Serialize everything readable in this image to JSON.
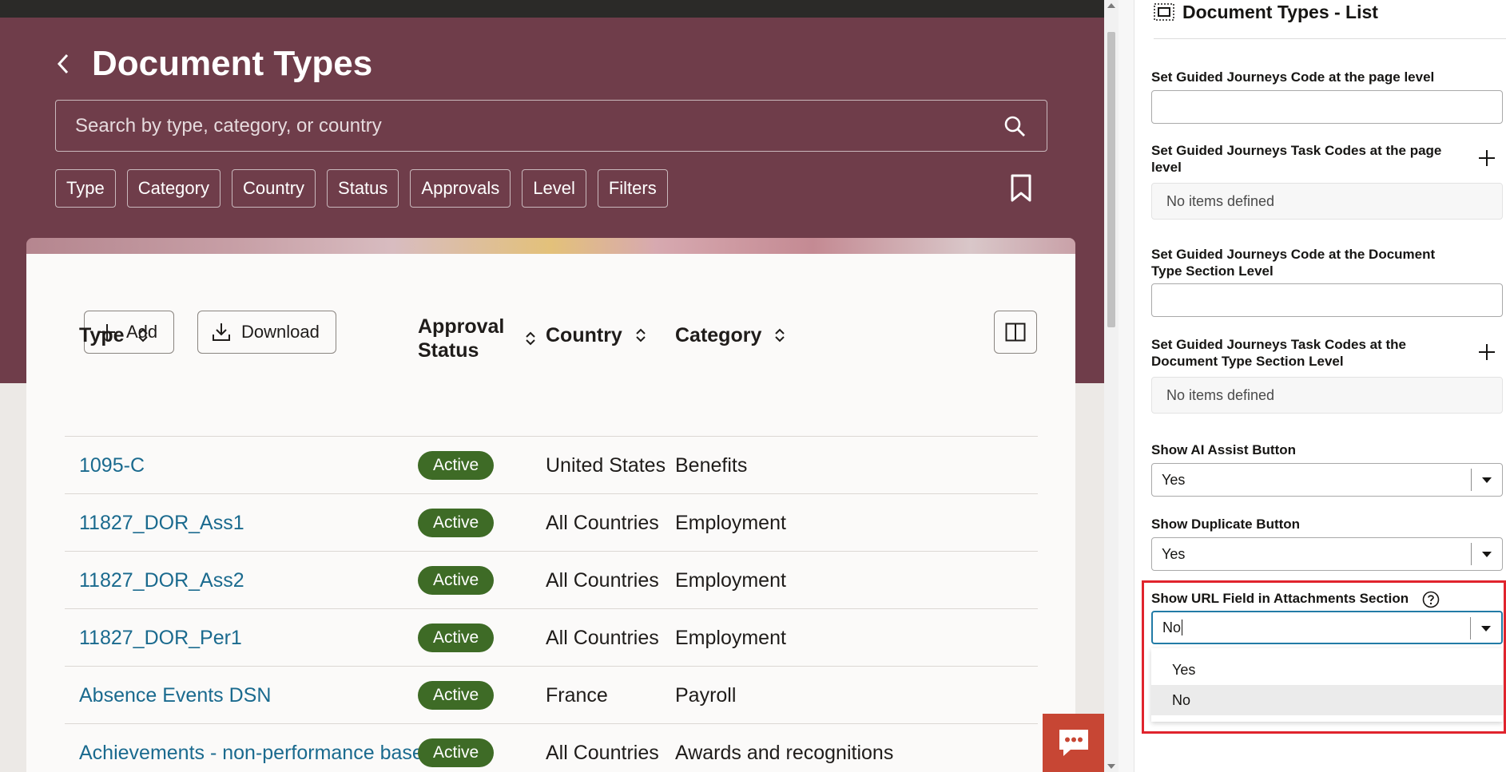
{
  "header": {
    "title": "Document Types",
    "search_placeholder": "Search by type, category, or country",
    "filter_chips": [
      "Type",
      "Category",
      "Country",
      "Status",
      "Approvals",
      "Level",
      "Filters"
    ]
  },
  "toolbar": {
    "add_label": "Add",
    "download_label": "Download"
  },
  "table": {
    "columns": [
      "Type",
      "Approval Status",
      "Country",
      "Category"
    ],
    "rows": [
      {
        "type": "1095-C",
        "status": "Active",
        "country": "United States",
        "category": "Benefits"
      },
      {
        "type": "11827_DOR_Ass1",
        "status": "Active",
        "country": "All Countries",
        "category": "Employment"
      },
      {
        "type": "11827_DOR_Ass2",
        "status": "Active",
        "country": "All Countries",
        "category": "Employment"
      },
      {
        "type": "11827_DOR_Per1",
        "status": "Active",
        "country": "All Countries",
        "category": "Employment"
      },
      {
        "type": "Absence Events DSN",
        "status": "Active",
        "country": "France",
        "category": "Payroll"
      },
      {
        "type": "Achievements - non-performance based",
        "status": "Active",
        "country": "All Countries",
        "category": "Awards and recognitions"
      }
    ]
  },
  "panel": {
    "title": "Document Types - List",
    "fields": {
      "gj_page_code_label": "Set Guided Journeys Code at the page level",
      "gj_page_code_value": "",
      "gj_page_tasks_label": "Set Guided Journeys Task Codes at the page level",
      "gj_page_tasks_empty": "No items defined",
      "gj_section_code_label": "Set Guided Journeys Code at the Document Type Section Level",
      "gj_section_code_value": "",
      "gj_section_tasks_label": "Set Guided Journeys Task Codes at the Document Type Section Level",
      "gj_section_tasks_empty": "No items defined",
      "ai_assist_label": "Show AI Assist Button",
      "ai_assist_value": "Yes",
      "duplicate_label": "Show Duplicate Button",
      "duplicate_value": "Yes",
      "url_field_label": "Show URL Field in Attachments Section",
      "url_field_value": "No",
      "url_field_options": [
        "Yes",
        "No"
      ]
    }
  },
  "colors": {
    "hero": "#6f3d4a",
    "link": "#1a6a8e",
    "badge": "#3e6b26",
    "chat": "#c74634",
    "highlight": "#e0242d"
  }
}
